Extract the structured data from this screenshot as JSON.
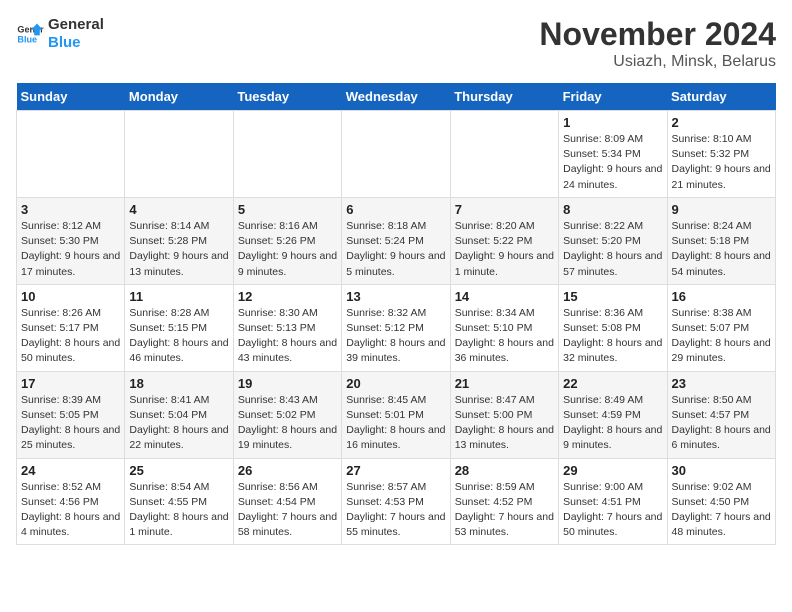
{
  "header": {
    "logo_line1": "General",
    "logo_line2": "Blue",
    "title": "November 2024",
    "subtitle": "Usiazh, Minsk, Belarus"
  },
  "days_of_week": [
    "Sunday",
    "Monday",
    "Tuesday",
    "Wednesday",
    "Thursday",
    "Friday",
    "Saturday"
  ],
  "weeks": [
    [
      {
        "day": "",
        "info": ""
      },
      {
        "day": "",
        "info": ""
      },
      {
        "day": "",
        "info": ""
      },
      {
        "day": "",
        "info": ""
      },
      {
        "day": "",
        "info": ""
      },
      {
        "day": "1",
        "info": "Sunrise: 8:09 AM\nSunset: 5:34 PM\nDaylight: 9 hours and 24 minutes."
      },
      {
        "day": "2",
        "info": "Sunrise: 8:10 AM\nSunset: 5:32 PM\nDaylight: 9 hours and 21 minutes."
      }
    ],
    [
      {
        "day": "3",
        "info": "Sunrise: 8:12 AM\nSunset: 5:30 PM\nDaylight: 9 hours and 17 minutes."
      },
      {
        "day": "4",
        "info": "Sunrise: 8:14 AM\nSunset: 5:28 PM\nDaylight: 9 hours and 13 minutes."
      },
      {
        "day": "5",
        "info": "Sunrise: 8:16 AM\nSunset: 5:26 PM\nDaylight: 9 hours and 9 minutes."
      },
      {
        "day": "6",
        "info": "Sunrise: 8:18 AM\nSunset: 5:24 PM\nDaylight: 9 hours and 5 minutes."
      },
      {
        "day": "7",
        "info": "Sunrise: 8:20 AM\nSunset: 5:22 PM\nDaylight: 9 hours and 1 minute."
      },
      {
        "day": "8",
        "info": "Sunrise: 8:22 AM\nSunset: 5:20 PM\nDaylight: 8 hours and 57 minutes."
      },
      {
        "day": "9",
        "info": "Sunrise: 8:24 AM\nSunset: 5:18 PM\nDaylight: 8 hours and 54 minutes."
      }
    ],
    [
      {
        "day": "10",
        "info": "Sunrise: 8:26 AM\nSunset: 5:17 PM\nDaylight: 8 hours and 50 minutes."
      },
      {
        "day": "11",
        "info": "Sunrise: 8:28 AM\nSunset: 5:15 PM\nDaylight: 8 hours and 46 minutes."
      },
      {
        "day": "12",
        "info": "Sunrise: 8:30 AM\nSunset: 5:13 PM\nDaylight: 8 hours and 43 minutes."
      },
      {
        "day": "13",
        "info": "Sunrise: 8:32 AM\nSunset: 5:12 PM\nDaylight: 8 hours and 39 minutes."
      },
      {
        "day": "14",
        "info": "Sunrise: 8:34 AM\nSunset: 5:10 PM\nDaylight: 8 hours and 36 minutes."
      },
      {
        "day": "15",
        "info": "Sunrise: 8:36 AM\nSunset: 5:08 PM\nDaylight: 8 hours and 32 minutes."
      },
      {
        "day": "16",
        "info": "Sunrise: 8:38 AM\nSunset: 5:07 PM\nDaylight: 8 hours and 29 minutes."
      }
    ],
    [
      {
        "day": "17",
        "info": "Sunrise: 8:39 AM\nSunset: 5:05 PM\nDaylight: 8 hours and 25 minutes."
      },
      {
        "day": "18",
        "info": "Sunrise: 8:41 AM\nSunset: 5:04 PM\nDaylight: 8 hours and 22 minutes."
      },
      {
        "day": "19",
        "info": "Sunrise: 8:43 AM\nSunset: 5:02 PM\nDaylight: 8 hours and 19 minutes."
      },
      {
        "day": "20",
        "info": "Sunrise: 8:45 AM\nSunset: 5:01 PM\nDaylight: 8 hours and 16 minutes."
      },
      {
        "day": "21",
        "info": "Sunrise: 8:47 AM\nSunset: 5:00 PM\nDaylight: 8 hours and 13 minutes."
      },
      {
        "day": "22",
        "info": "Sunrise: 8:49 AM\nSunset: 4:59 PM\nDaylight: 8 hours and 9 minutes."
      },
      {
        "day": "23",
        "info": "Sunrise: 8:50 AM\nSunset: 4:57 PM\nDaylight: 8 hours and 6 minutes."
      }
    ],
    [
      {
        "day": "24",
        "info": "Sunrise: 8:52 AM\nSunset: 4:56 PM\nDaylight: 8 hours and 4 minutes."
      },
      {
        "day": "25",
        "info": "Sunrise: 8:54 AM\nSunset: 4:55 PM\nDaylight: 8 hours and 1 minute."
      },
      {
        "day": "26",
        "info": "Sunrise: 8:56 AM\nSunset: 4:54 PM\nDaylight: 7 hours and 58 minutes."
      },
      {
        "day": "27",
        "info": "Sunrise: 8:57 AM\nSunset: 4:53 PM\nDaylight: 7 hours and 55 minutes."
      },
      {
        "day": "28",
        "info": "Sunrise: 8:59 AM\nSunset: 4:52 PM\nDaylight: 7 hours and 53 minutes."
      },
      {
        "day": "29",
        "info": "Sunrise: 9:00 AM\nSunset: 4:51 PM\nDaylight: 7 hours and 50 minutes."
      },
      {
        "day": "30",
        "info": "Sunrise: 9:02 AM\nSunset: 4:50 PM\nDaylight: 7 hours and 48 minutes."
      }
    ]
  ]
}
